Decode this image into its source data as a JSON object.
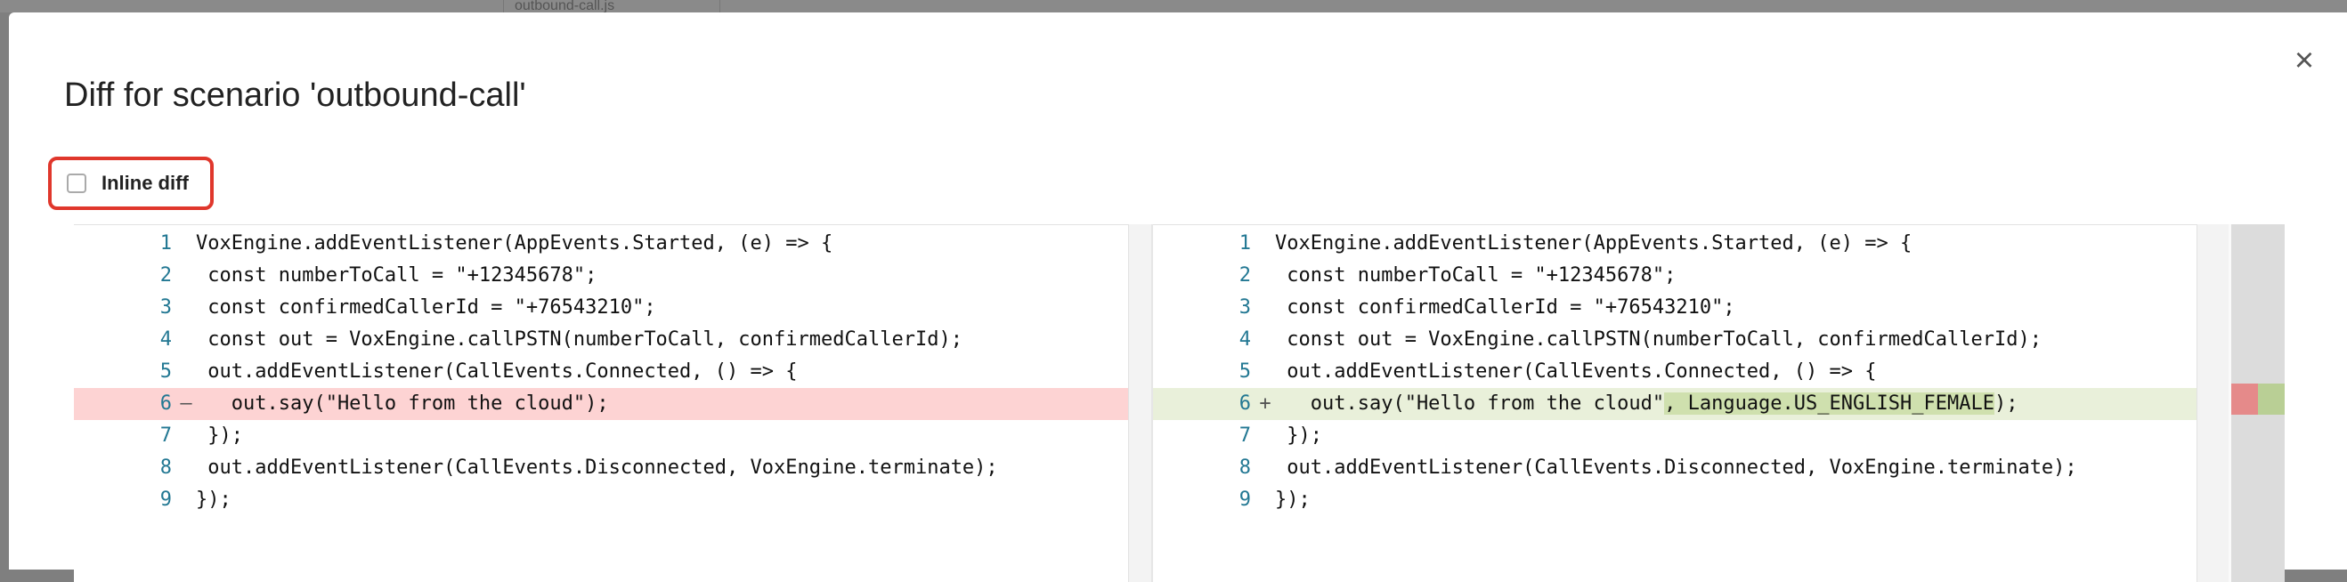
{
  "background": {
    "tab_label": "outbound-call.js"
  },
  "dialog": {
    "title": "Diff for scenario 'outbound-call'",
    "close_symbol": "×",
    "inline_diff_label": "Inline diff",
    "inline_diff_checked": false
  },
  "colors": {
    "deleted_line": "#fdd3d3",
    "inserted_line": "#e9f0da",
    "highlight_border": "#e0372c",
    "line_number": "#237893"
  },
  "diff": {
    "original": [
      {
        "num": "1",
        "marker": "",
        "text": "VoxEngine.addEventListener(AppEvents.Started, (e) => {",
        "type": "normal"
      },
      {
        "num": "2",
        "marker": "",
        "text": " const numberToCall = \"+12345678\";",
        "type": "normal"
      },
      {
        "num": "3",
        "marker": "",
        "text": " const confirmedCallerId = \"+76543210\";",
        "type": "normal"
      },
      {
        "num": "4",
        "marker": "",
        "text": " const out = VoxEngine.callPSTN(numberToCall, confirmedCallerId);",
        "type": "normal"
      },
      {
        "num": "5",
        "marker": "",
        "text": " out.addEventListener(CallEvents.Connected, () => {",
        "type": "normal"
      },
      {
        "num": "6",
        "marker": "–",
        "text": "   out.say(\"Hello from the cloud\");",
        "type": "del"
      },
      {
        "num": "7",
        "marker": "",
        "text": " });",
        "type": "normal"
      },
      {
        "num": "8",
        "marker": "",
        "text": " out.addEventListener(CallEvents.Disconnected, VoxEngine.terminate);",
        "type": "normal"
      },
      {
        "num": "9",
        "marker": "",
        "text": "});",
        "type": "normal"
      }
    ],
    "modified": [
      {
        "num": "1",
        "marker": "",
        "text": "VoxEngine.addEventListener(AppEvents.Started, (e) => {",
        "type": "normal"
      },
      {
        "num": "2",
        "marker": "",
        "text": " const numberToCall = \"+12345678\";",
        "type": "normal"
      },
      {
        "num": "3",
        "marker": "",
        "text": " const confirmedCallerId = \"+76543210\";",
        "type": "normal"
      },
      {
        "num": "4",
        "marker": "",
        "text": " const out = VoxEngine.callPSTN(numberToCall, confirmedCallerId);",
        "type": "normal"
      },
      {
        "num": "5",
        "marker": "",
        "text": " out.addEventListener(CallEvents.Connected, () => {",
        "type": "normal"
      },
      {
        "num": "6",
        "marker": "+",
        "text": "   out.say(\"Hello from the cloud\", Language.US_ENGLISH_FEMALE);",
        "type": "ins"
      },
      {
        "num": "7",
        "marker": "",
        "text": " });",
        "type": "normal"
      },
      {
        "num": "8",
        "marker": "",
        "text": " out.addEventListener(CallEvents.Disconnected, VoxEngine.terminate);",
        "type": "normal"
      },
      {
        "num": "9",
        "marker": "",
        "text": "});",
        "type": "normal"
      }
    ]
  }
}
